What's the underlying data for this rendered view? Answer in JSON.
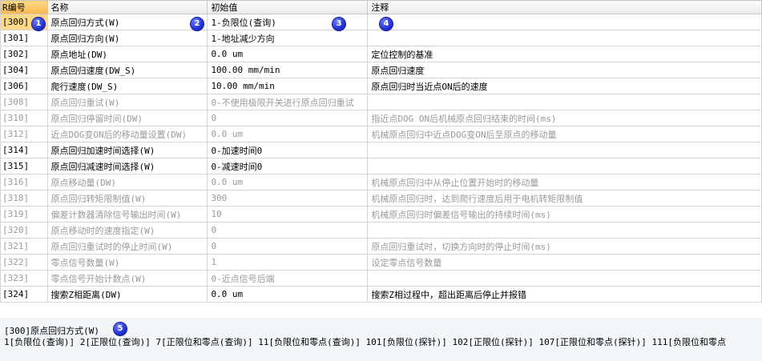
{
  "header": {
    "no": "R编号",
    "name": "名称",
    "initial": "初始值",
    "note": "注释"
  },
  "rows": [
    {
      "no": "[300]",
      "name": "原点回归方式(W)",
      "value": "1-负限位(查询)",
      "note": "",
      "state": "selected"
    },
    {
      "no": "[301]",
      "name": "原点回归方向(W)",
      "value": "1-地址减少方向",
      "note": "",
      "state": "enabled"
    },
    {
      "no": "[302]",
      "name": "原点地址(DW)",
      "value": "0.0 um",
      "note": "定位控制的基准",
      "state": "enabled"
    },
    {
      "no": "[304]",
      "name": "原点回归速度(DW_S)",
      "value": "100.00 mm/min",
      "note": "原点回归速度",
      "state": "enabled"
    },
    {
      "no": "[306]",
      "name": "爬行速度(DW_S)",
      "value": "10.00 mm/min",
      "note": "原点回归时当近点ON后的速度",
      "state": "enabled"
    },
    {
      "no": "[308]",
      "name": "原点回归重试(W)",
      "value": "0-不使用极限开关进行原点回归重试",
      "note": "",
      "state": "disabled"
    },
    {
      "no": "[310]",
      "name": "原点回归停留时间(DW)",
      "value": "0",
      "note": "指近点DOG ON后机械原点回归结束的时间(ms)",
      "state": "disabled"
    },
    {
      "no": "[312]",
      "name": "近点DOG变ON后的移动量设置(DW)",
      "value": "0.0 um",
      "note": "机械原点回归中近点DOG变ON后至原点的移动量",
      "state": "disabled"
    },
    {
      "no": "[314]",
      "name": "原点回归加速时间选择(W)",
      "value": "0-加速时间0",
      "note": "",
      "state": "enabled"
    },
    {
      "no": "[315]",
      "name": "原点回归减速时间选择(W)",
      "value": "0-减速时间0",
      "note": "",
      "state": "enabled"
    },
    {
      "no": "[316]",
      "name": "原点移动量(DW)",
      "value": "0.0 um",
      "note": "机械原点回归中从停止位置开始时的移动量",
      "state": "disabled"
    },
    {
      "no": "[318]",
      "name": "原点回归转矩限制值(W)",
      "value": "300",
      "note": "机械原点回归时，达到爬行速度后用于电机转矩限制值",
      "state": "disabled"
    },
    {
      "no": "[319]",
      "name": "偏差计数器清除信号输出时间(W)",
      "value": "10",
      "note": "机械原点回归时偏差信号输出的持续时间(ms)",
      "state": "disabled"
    },
    {
      "no": "[320]",
      "name": "原点移动时的速度指定(W)",
      "value": "0",
      "note": "",
      "state": "disabled"
    },
    {
      "no": "[321]",
      "name": "原点回归重试时的停止时间(W)",
      "value": "0",
      "note": "原点回归重试时，切换方向时的停止时间(ms)",
      "state": "disabled"
    },
    {
      "no": "[322]",
      "name": "零点信号数量(W)",
      "value": "1",
      "note": "设定零点信号数量",
      "state": "disabled"
    },
    {
      "no": "[323]",
      "name": "零点信号开始计数点(W)",
      "value": "0-近点信号后端",
      "note": "",
      "state": "disabled"
    },
    {
      "no": "[324]",
      "name": "搜索Z相距离(DW)",
      "value": "0.0 um",
      "note": "搜索Z相过程中，超出距离后停止并报错",
      "state": "enabled"
    }
  ],
  "markers": [
    "1",
    "2",
    "3",
    "4",
    "5"
  ],
  "description": {
    "title": "[300]原点回归方式(W)",
    "options": "1[负限位(查询)]  2[正限位(查询)]  7[正限位和零点(查询)]  11[负限位和零点(查询)]  101[负限位(探针)]  102[正限位(探针)]  107[正限位和零点(探针)]  111[负限位和零点"
  },
  "colors": {
    "selected_row": "#ffd88a",
    "disabled_text": "#9a9a9a",
    "marker": "#1626c8"
  }
}
